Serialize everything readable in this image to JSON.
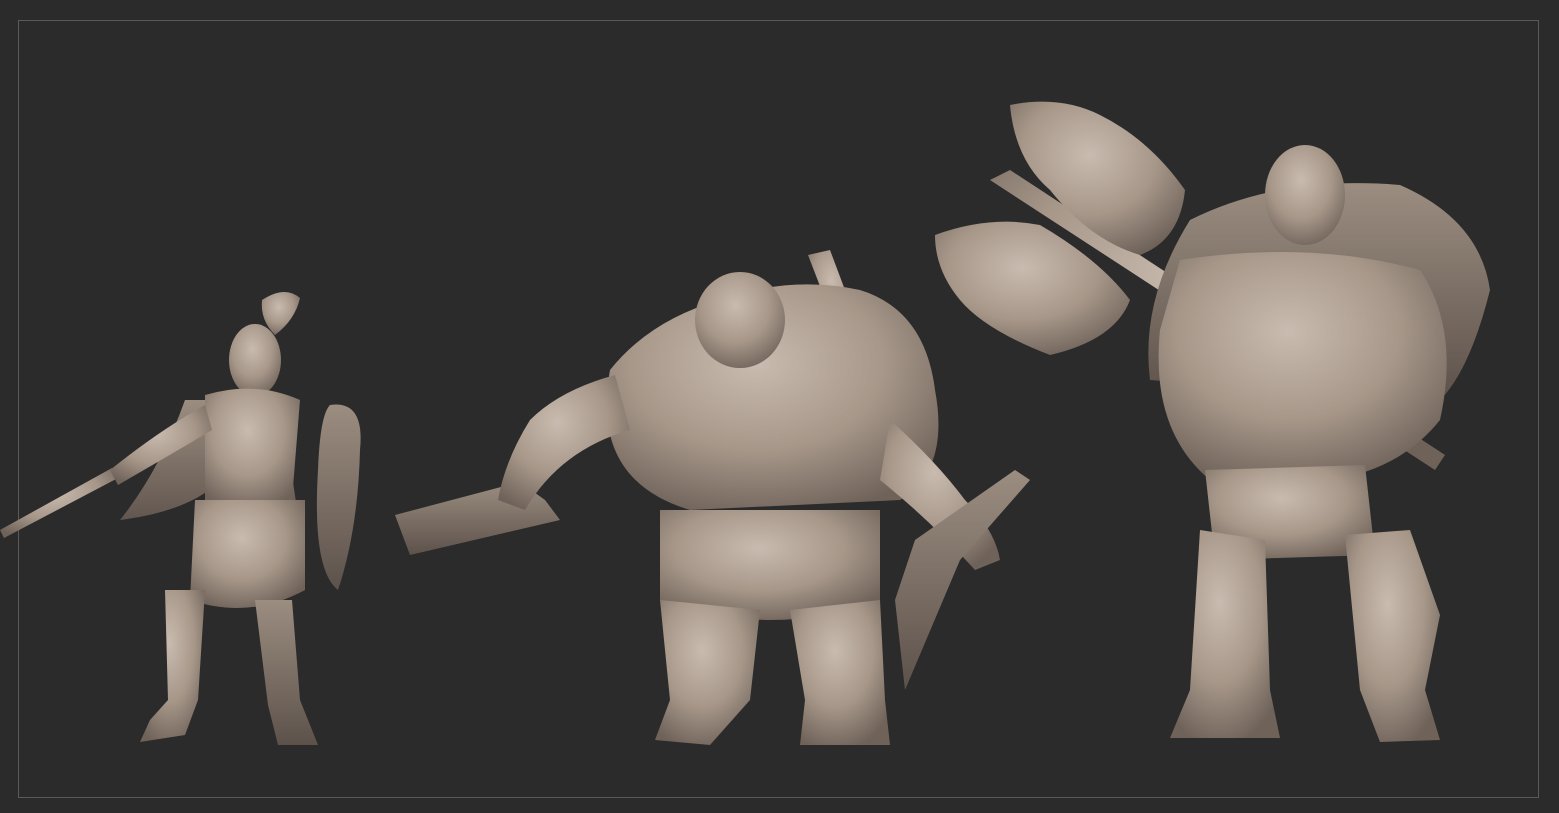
{
  "scene": {
    "background_color": "#2b2b2b",
    "frame_color": "#5a5a5a",
    "clay_color": "#a89a8d",
    "figures": [
      {
        "name": "spear-warrior",
        "description_icon": "spartan-warrior-figure"
      },
      {
        "name": "club-orc",
        "description_icon": "orc-brute-figure"
      },
      {
        "name": "axe-orc",
        "description_icon": "orc-axe-figure"
      }
    ]
  }
}
